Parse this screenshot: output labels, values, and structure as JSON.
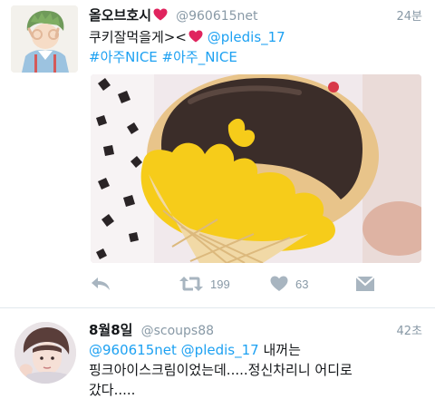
{
  "tweets": [
    {
      "display_name": "올오브호시",
      "handle": "@960615net",
      "time": "24분",
      "text_before": "쿠키잘먹을게><",
      "mention": "@pledis_17",
      "hashtag_1": "#아주NICE",
      "hashtag_2": "#아주_NICE",
      "retweet_count": "199",
      "like_count": "63"
    },
    {
      "display_name": "8월8일",
      "handle": "@scoups88",
      "time": "42초",
      "mention_1": "@960615net",
      "mention_2": "@pledis_17",
      "text_line_1": "내꺼는",
      "text_line_2": "핑크아이스크림이었는데.....정신차리니 어디로",
      "text_line_3": "갔다....."
    }
  ],
  "colors": {
    "link": "#1da1f2",
    "muted": "#8899a6",
    "heart": "#e0245e"
  },
  "icons": [
    "heart-icon",
    "reply-icon",
    "retweet-icon",
    "like-icon",
    "direct-message-icon"
  ]
}
